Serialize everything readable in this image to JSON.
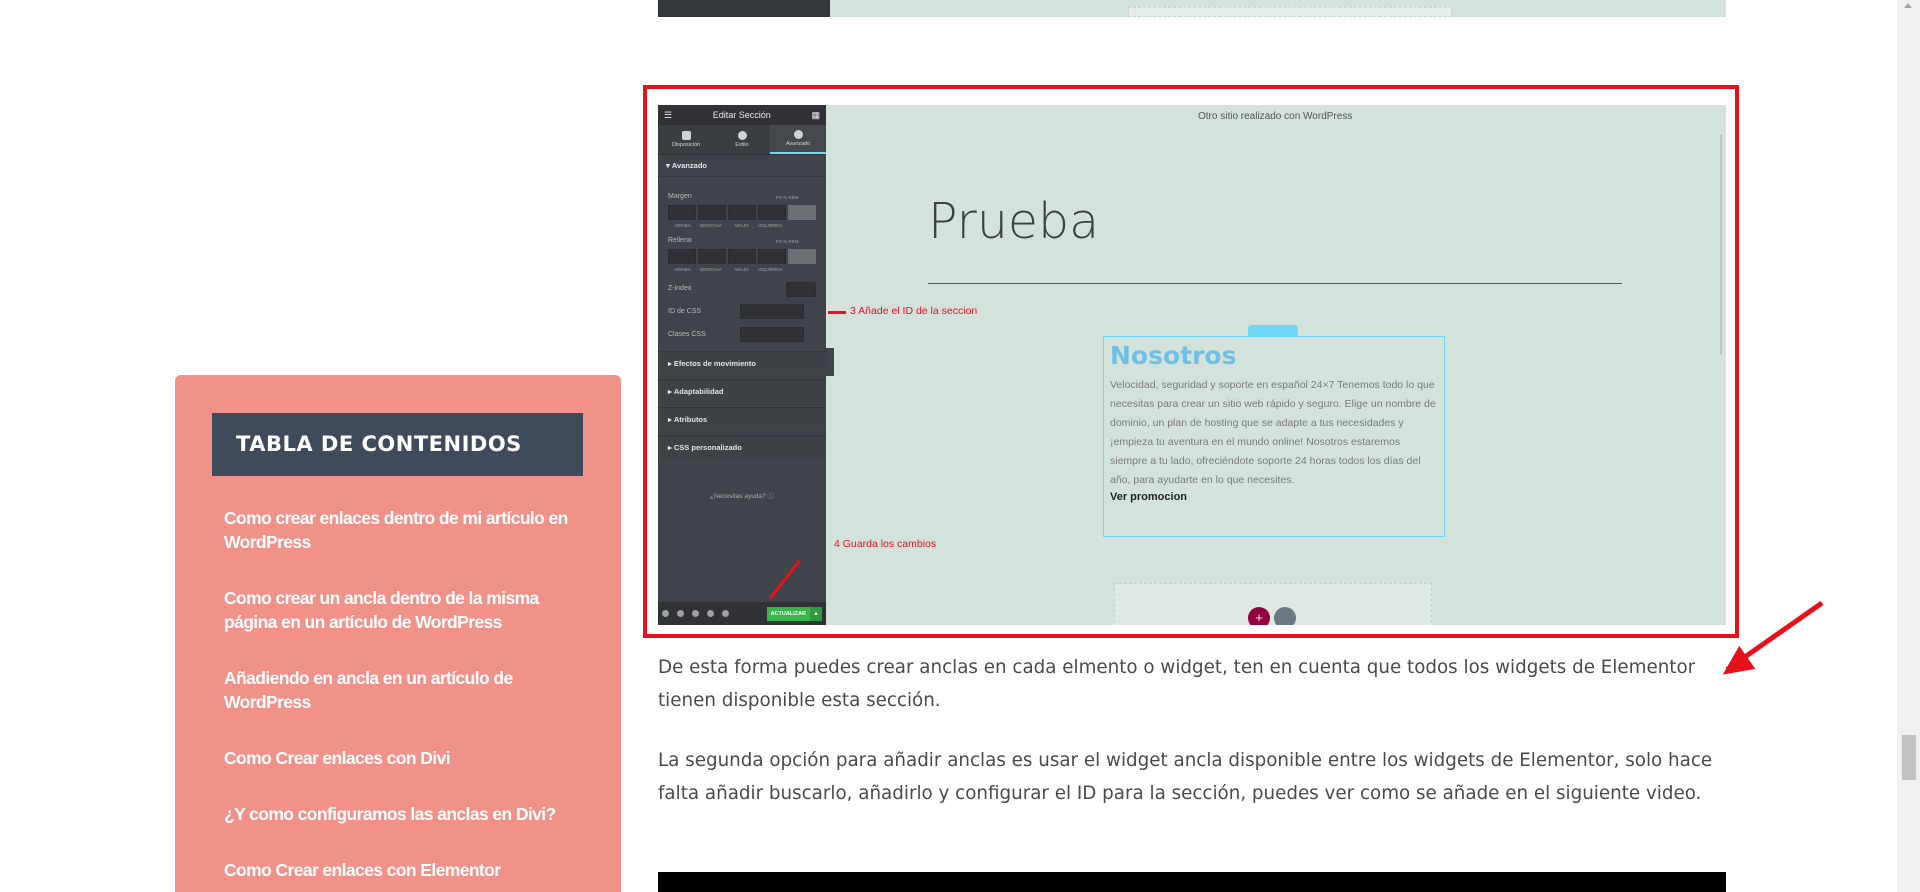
{
  "toc": {
    "title": "TABLA DE CONTENIDOS",
    "items": [
      "Como crear enlaces dentro de mi artículo en WordPress",
      "Como crear un ancla dentro de la misma página en un artículo de WordPress",
      "Añadiendo en ancla en un artículo de WordPress",
      "Como Crear enlaces con Divi",
      "¿Y como configuramos las anclas en Divi?",
      "Como Crear enlaces con Elementor"
    ]
  },
  "screenshot": {
    "panel_title": "Editar Sección",
    "tabs": [
      "Disposición",
      "Estilo",
      "Avanzado"
    ],
    "section_avanzado": "Avanzado",
    "margin_label": "Margen",
    "padding_label": "Relleno",
    "unit_text": "PX % REM",
    "sides": [
      "ARRIBA",
      "DERECHA",
      "ABAJO",
      "IZQUIERDA"
    ],
    "zindex_label": "Z-index",
    "css_id_label": "ID de CSS",
    "css_classes_label": "Clases CSS",
    "accordions": [
      "Efectos de movimiento",
      "Adaptabilidad",
      "Atributos",
      "CSS personalizado"
    ],
    "help": "¿Necesitas ayuda?",
    "update_button": "ACTUALIZAR",
    "canvas_note": "Otro sitio realizado con WordPress",
    "heading": "Prueba",
    "note_step3": "3 Añade el ID de la seccion",
    "note_step4": "4 Guarda los cambios",
    "widget_title": "Nosotros",
    "widget_body": "Velocidad, seguridad y soporte en español 24×7 Tenemos todo lo que necesitas para crear un sitio web rápido y seguro. Elige un nombre de dominio, un plan de hosting que se adapte a tus necesidades y ¡empieza tu aventura en el mundo online! Nosotros estaremos siempre a tu lado, ofreciéndote soporte 24 horas todos los días del año, para ayudarte en lo que necesites.",
    "widget_link": "Ver promocion"
  },
  "article": {
    "para1": "De esta forma puedes crear anclas en cada elmento o widget, ten en cuenta que todos los widgets de Elementor tienen disponible esta sección.",
    "para2": "La segunda opción para añadir anclas es usar el widget ancla disponible entre los widgets de Elementor, solo hace falta añadir buscarlo, añadirlo y configurar el ID para la sección, puedes ver como se añade en el siguiente video."
  },
  "colors": {
    "toc_bg": "#f0928a",
    "toc_header_bg": "#3f4b5b",
    "highlight_red": "#e8101a",
    "canvas_bg": "#d3e3dc"
  }
}
